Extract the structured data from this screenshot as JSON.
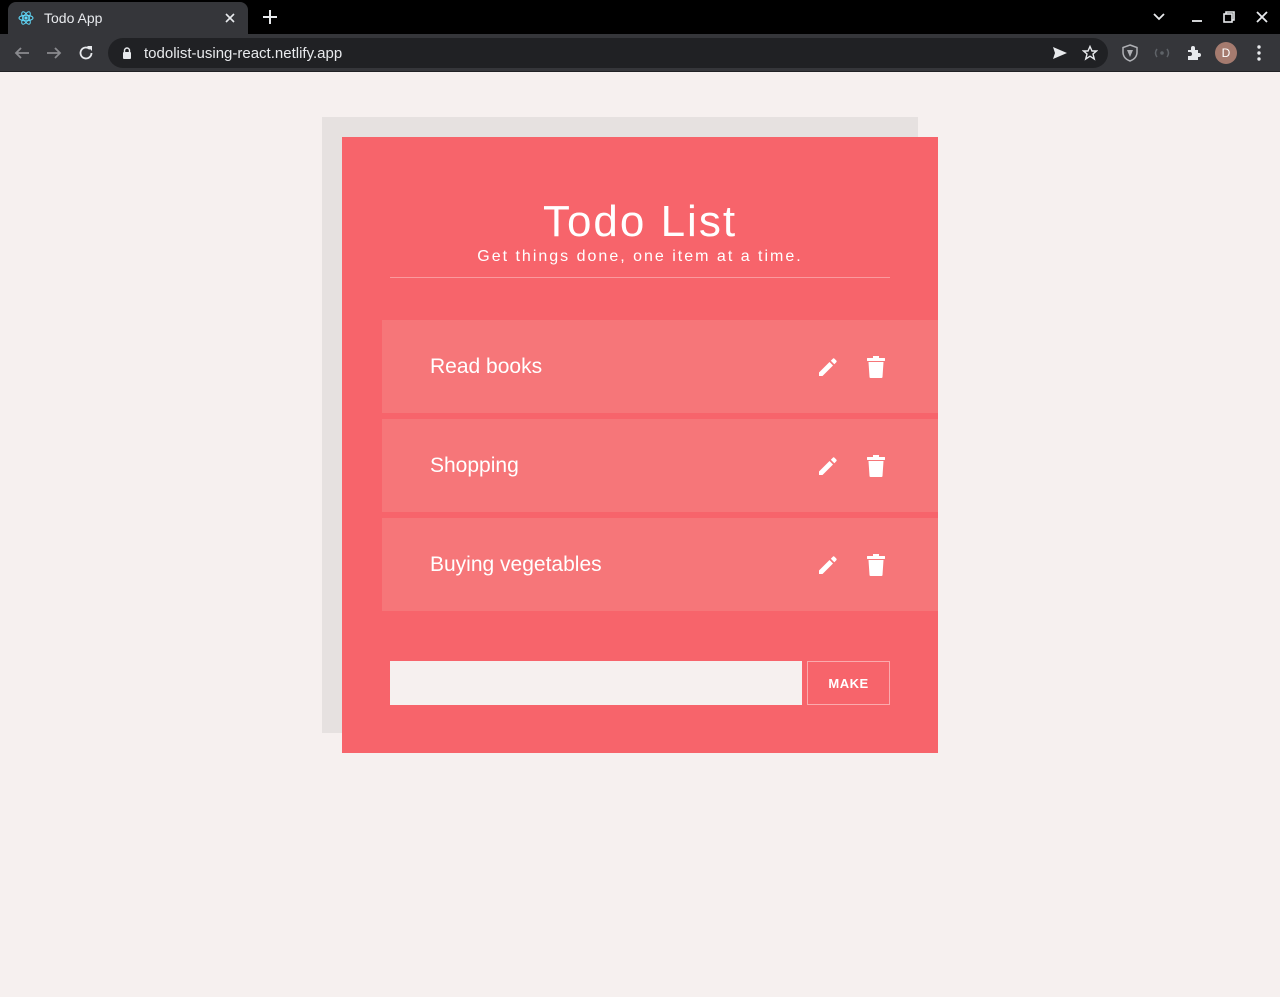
{
  "browser": {
    "tab_title": "Todo App",
    "url": "todolist-using-react.netlify.app",
    "avatar_initial": "D",
    "colors": {
      "frame": "#000000",
      "toolbar": "#35363a",
      "omnibox": "#202124"
    }
  },
  "app": {
    "title": "Todo List",
    "subtitle": "Get things done, one item at a time.",
    "todos": [
      {
        "text": "Read books"
      },
      {
        "text": "Shopping"
      },
      {
        "text": "Buying vegetables"
      }
    ],
    "input": {
      "value": "",
      "placeholder": ""
    },
    "make_label": "MAKE",
    "icons": {
      "edit": "pencil-icon",
      "delete": "trash-icon"
    },
    "colors": {
      "card": "#f7646b",
      "item": "#f67679",
      "page": "#f6f0ef",
      "shadow": "#e6e1e0"
    }
  }
}
